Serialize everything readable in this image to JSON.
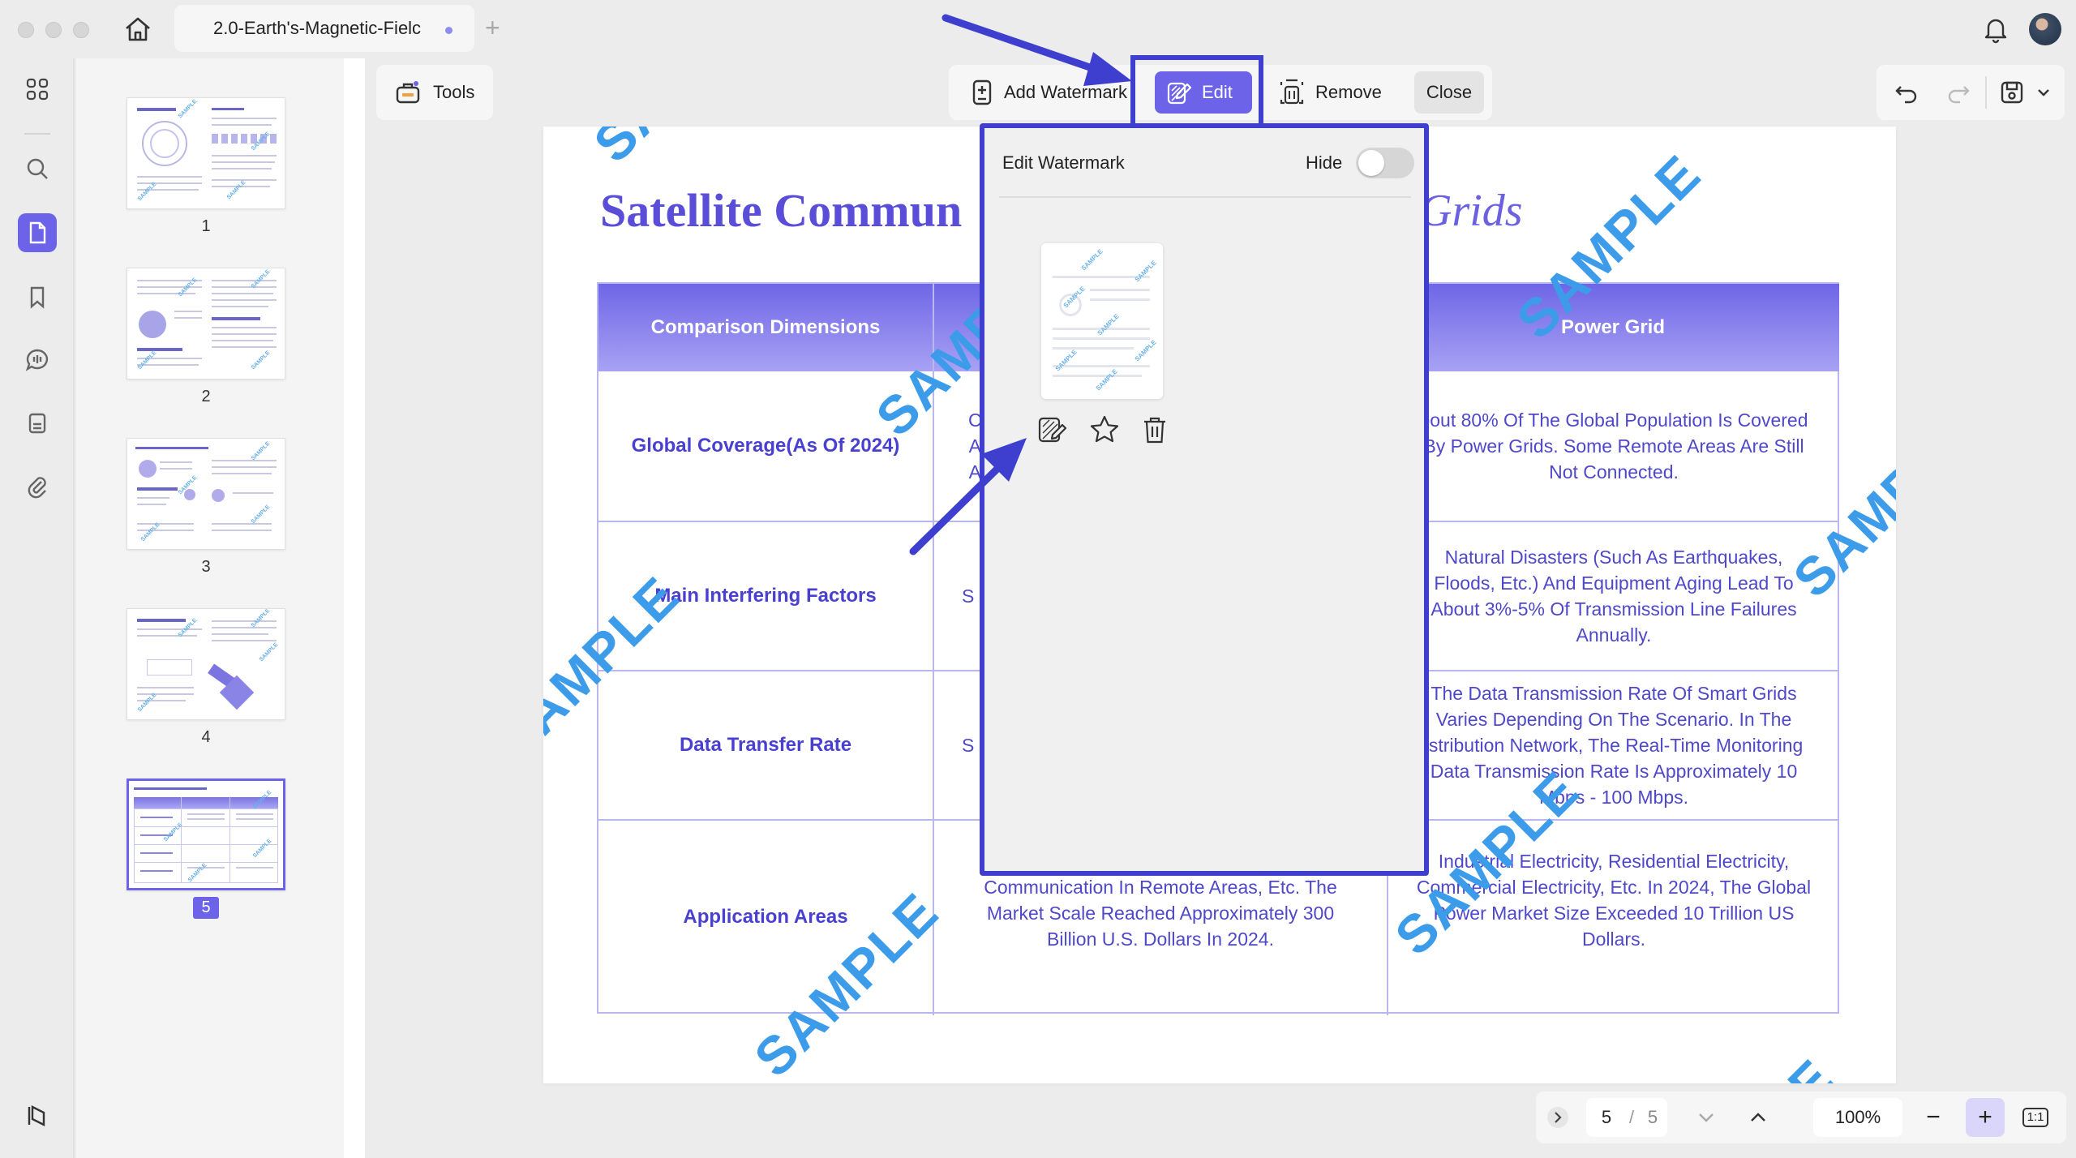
{
  "window": {
    "tab_title": "2.0-Earth's-Magnetic-Fielc",
    "new_tab_symbol": "+"
  },
  "rail": {
    "items": [
      "home-grid",
      "search",
      "pages",
      "bookmark",
      "comment",
      "forms",
      "attachment"
    ],
    "active": "pages"
  },
  "thumbnails": {
    "pages": [
      "1",
      "2",
      "3",
      "4",
      "5"
    ],
    "current": "5"
  },
  "toolbar": {
    "tools_label": "Tools",
    "add_watermark_label": "Add Watermark",
    "edit_label": "Edit",
    "remove_label": "Remove",
    "close_label": "Close"
  },
  "document": {
    "title_visible": "Satellite Commun",
    "title_tail": "Grids",
    "table": {
      "headers": [
        "Comparison Dimensions",
        "",
        "Power Grid"
      ],
      "rows": [
        {
          "dimension": "Global Coverage(As Of 2024)",
          "middle": "C\nA\nA",
          "power_grid": "bout 80% Of The Global Population Is Covered By Power Grids. Some Remote Areas Are Still Not Connected."
        },
        {
          "dimension": "Main Interfering Factors",
          "middle": "S",
          "power_grid": "Natural Disasters (Such As Earthquakes, Floods, Etc.) And Equipment Aging Lead To About 3%-5% Of Transmission Line Failures Annually."
        },
        {
          "dimension": "Data Transfer Rate",
          "middle": "S",
          "power_grid": "The Data Transmission Rate Of Smart Grids Varies Depending On The Scenario. In The istribution Network, The Real-Time Monitoring Data Transmission Rate Is Approximately 10 Mbps - 100 Mbps."
        },
        {
          "dimension": "Application Areas",
          "middle": "Communication, Aviation Communication, Communication In Remote Areas, Etc. The Market Scale Reached Approximately 300 Billion U.S. Dollars In 2024.",
          "power_grid": "Industrial Electricity, Residential Electricity, Commercial Electricity, Etc. In 2024, The Global Power Market Size Exceeded 10 Trillion US Dollars."
        }
      ]
    },
    "watermark_text": "SAMPLE",
    "watermark_partial": [
      "SAMP",
      "SAMPLE",
      "SA",
      "E"
    ]
  },
  "watermark_panel": {
    "title": "Edit Watermark",
    "hide_label": "Hide",
    "hide_on": false,
    "card_watermark_text": "SAMPLE"
  },
  "pager": {
    "current_page": "5",
    "separator": "/",
    "total_pages": "5",
    "zoom": "100%",
    "minus": "−",
    "plus": "+",
    "fit_label": "1:1"
  },
  "colors": {
    "accent": "#6c63e8",
    "annotation": "#3f3fcf",
    "watermark": "#3d9cea",
    "table_text": "#4f48c8"
  }
}
